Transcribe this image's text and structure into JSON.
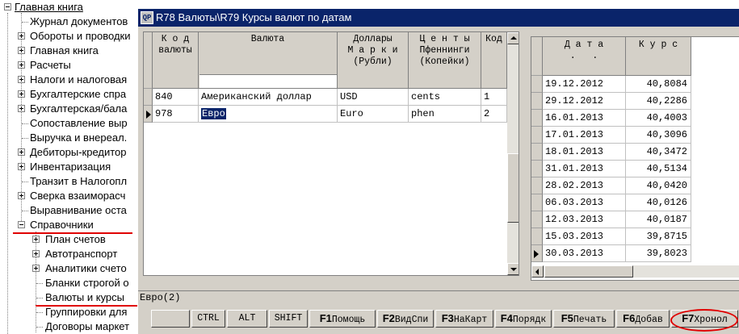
{
  "tree": {
    "root": "Главная книга",
    "items": [
      {
        "label": "Журнал документов",
        "expand": ""
      },
      {
        "label": "Обороты и проводки",
        "expand": "plus"
      },
      {
        "label": "Главная книга",
        "expand": "plus"
      },
      {
        "label": "Расчеты",
        "expand": "plus"
      },
      {
        "label": "Налоги и налоговая",
        "expand": "plus"
      },
      {
        "label": "Бухгалтерские спра",
        "expand": "plus"
      },
      {
        "label": "Бухгалтерская/бала",
        "expand": "plus"
      },
      {
        "label": "Сопоставление выр",
        "expand": ""
      },
      {
        "label": "Выручка и внереал.",
        "expand": ""
      },
      {
        "label": "Дебиторы-кредитор",
        "expand": "plus"
      },
      {
        "label": "Инвентаризация",
        "expand": "plus"
      },
      {
        "label": "Транзит в Налогопл",
        "expand": ""
      },
      {
        "label": "Сверка взаиморасч",
        "expand": "plus"
      },
      {
        "label": "Выравнивание оста",
        "expand": ""
      },
      {
        "label": "Справочники",
        "expand": "minus"
      }
    ],
    "sub_items": [
      {
        "label": "План счетов",
        "expand": "plus"
      },
      {
        "label": "Автотранспорт",
        "expand": "plus"
      },
      {
        "label": "Аналитики счето",
        "expand": "plus"
      },
      {
        "label": "Бланки строгой о",
        "expand": ""
      },
      {
        "label": "Валюты и курсы",
        "expand": ""
      },
      {
        "label": "Группировки для",
        "expand": ""
      },
      {
        "label": "Договоры маркет",
        "expand": ""
      }
    ]
  },
  "window": {
    "icon_text": "QP",
    "title": "R78 Валюты\\R79 Курсы валют по датам"
  },
  "currency_grid": {
    "columns": [
      {
        "label": "К о д\nвалюты"
      },
      {
        "label": "Валюта"
      },
      {
        "label": "Доллары\nМ а р к и\n(Рубли)"
      },
      {
        "label": "Ц е н т ы\nПфеннинги\n(Копейки)"
      },
      {
        "label": "Код"
      }
    ],
    "rows": [
      {
        "code": "840",
        "name": "Американский доллар",
        "major": "USD",
        "minor": "cents",
        "extra": "1",
        "current": false
      },
      {
        "code": "978",
        "name": "Евро",
        "major": "Euro",
        "minor": "phen",
        "extra": "2",
        "current": true
      }
    ]
  },
  "rates_grid": {
    "col_date": "Д а т а\n.   .",
    "col_rate": "К у р с",
    "rows": [
      {
        "date": "19.12.2012",
        "rate": "40,8084",
        "current": false
      },
      {
        "date": "29.12.2012",
        "rate": "40,2286",
        "current": false
      },
      {
        "date": "16.01.2013",
        "rate": "40,4003",
        "current": false
      },
      {
        "date": "17.01.2013",
        "rate": "40,3096",
        "current": false
      },
      {
        "date": "18.01.2013",
        "rate": "40,3472",
        "current": false
      },
      {
        "date": "31.01.2013",
        "rate": "40,5134",
        "current": false
      },
      {
        "date": "28.02.2013",
        "rate": "40,0420",
        "current": false
      },
      {
        "date": "06.03.2013",
        "rate": "40,0126",
        "current": false
      },
      {
        "date": "12.03.2013",
        "rate": "40,0187",
        "current": false
      },
      {
        "date": "15.03.2013",
        "rate": "39,8715",
        "current": false
      },
      {
        "date": "30.03.2013",
        "rate": "39,8023",
        "current": true
      }
    ]
  },
  "status": {
    "text": "Евро(2)"
  },
  "fkeys": [
    {
      "key": "",
      "label": "CTRL"
    },
    {
      "key": "",
      "label": "ALT"
    },
    {
      "key": "",
      "label": "SHIFT"
    },
    {
      "key": "F1",
      "label": "Помощь"
    },
    {
      "key": "F2",
      "label": "ВидСпи"
    },
    {
      "key": "F3",
      "label": "НаКарт"
    },
    {
      "key": "F4",
      "label": "Порядк"
    },
    {
      "key": "F5",
      "label": "Печать"
    },
    {
      "key": "F6",
      "label": "Добав"
    },
    {
      "key": "F7",
      "label": "Хронол"
    }
  ],
  "colors": {
    "title_bar": "#0a246a",
    "face": "#d4d0c8",
    "highlight_circle": "#e00000",
    "selection": "#0a246a"
  }
}
